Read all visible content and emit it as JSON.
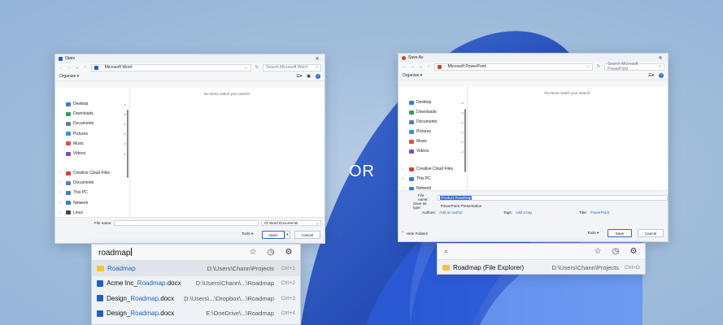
{
  "colors": {
    "accent": "#2e6fd0",
    "word": "#1f5fbf",
    "powerpoint": "#c9472b",
    "folder": "#f0c24a"
  },
  "separator": {
    "text": "OR"
  },
  "open_dialog": {
    "title": "Open",
    "address": "Microsoft Word",
    "search_placeholder": "Search Microsoft Word",
    "organize_label": "Organize ▾",
    "empty_message": "No items match your search.",
    "quick_access": [
      {
        "label": "Desktop",
        "icon": "desktop-icon",
        "color": "#3a7bd5"
      },
      {
        "label": "Downloads",
        "icon": "download-icon",
        "color": "#2f9e5f"
      },
      {
        "label": "Documents",
        "icon": "documents-icon",
        "color": "#5d7fa8"
      },
      {
        "label": "Pictures",
        "icon": "pictures-icon",
        "color": "#3b8fd6"
      },
      {
        "label": "Music",
        "icon": "music-icon",
        "color": "#d3544b"
      },
      {
        "label": "Videos",
        "icon": "videos-icon",
        "color": "#7c4bc4"
      }
    ],
    "tree": [
      {
        "label": "Creative Cloud Files",
        "icon": "cloud-icon",
        "color": "#d0413a"
      },
      {
        "label": "Documents",
        "icon": "documents-icon",
        "color": "#5d7fa8"
      },
      {
        "label": "This PC",
        "icon": "pc-icon",
        "color": "#3a7bd5"
      },
      {
        "label": "Network",
        "icon": "network-icon",
        "color": "#3a7bd5"
      },
      {
        "label": "Linux",
        "icon": "linux-icon",
        "color": "#444444"
      }
    ],
    "file_name_label": "File name:",
    "file_type": "All Word Documents",
    "tools_label": "Tools",
    "open_label": "Open",
    "cancel_label": "Cancel"
  },
  "save_dialog": {
    "title": "Save As",
    "address": "Microsoft PowerPoint",
    "search_placeholder": "Search Microsoft PowerPoint",
    "organize_label": "Organize ▾",
    "empty_message": "No items match your search.",
    "quick_access": [
      {
        "label": "Desktop",
        "icon": "desktop-icon",
        "color": "#3a7bd5"
      },
      {
        "label": "Downloads",
        "icon": "download-icon",
        "color": "#2f9e5f"
      },
      {
        "label": "Documents",
        "icon": "documents-icon",
        "color": "#5d7fa8"
      },
      {
        "label": "Pictures",
        "icon": "pictures-icon",
        "color": "#3b8fd6"
      },
      {
        "label": "Music",
        "icon": "music-icon",
        "color": "#d3544b"
      },
      {
        "label": "Videos",
        "icon": "videos-icon",
        "color": "#7c4bc4"
      }
    ],
    "tree": [
      {
        "label": "Creative Cloud Files",
        "icon": "cloud-icon",
        "color": "#d0413a"
      },
      {
        "label": "This PC",
        "icon": "pc-icon",
        "color": "#3a7bd5"
      },
      {
        "label": "Network",
        "icon": "network-icon",
        "color": "#3a7bd5"
      }
    ],
    "file_name_label": "File name:",
    "file_name_value": "Product Roadmap",
    "save_type_label": "Save as type:",
    "save_type_value": "PowerPoint Presentation",
    "authors_label": "Authors:",
    "authors_value": "Add an author",
    "tags_label": "Tags:",
    "tags_value": "Add a tag",
    "title_label": "Title:",
    "title_value": "PowerPoint",
    "hide_folders_label": "Hide Folders",
    "tools_label": "Tools",
    "save_label": "Save",
    "cancel_label": "Cancel"
  },
  "left_palette": {
    "query": "roadmap",
    "results": [
      {
        "icon": "folder-icon",
        "name_pre": "",
        "name_match": "Roadmap",
        "name_post": "",
        "path": "D:\\Users\\Chann\\Projects",
        "shortcut": "Ctrl+1",
        "highlight": true
      },
      {
        "icon": "word-icon",
        "name_pre": "Acme Inc_",
        "name_match": "Roadmap",
        "name_post": ".docx",
        "path": "D:\\Users\\Chann\\...\\Roadmap",
        "shortcut": "Ctrl+2",
        "highlight": false
      },
      {
        "icon": "word-icon",
        "name_pre": "Design_",
        "name_match": "Roadmap",
        "name_post": ".docx",
        "path": "D:\\Users\\...\\Dropbox\\...\\Roadmap",
        "shortcut": "Ctrl+3",
        "highlight": false
      },
      {
        "icon": "word-icon",
        "name_pre": "Design_",
        "name_match": "Roadmap",
        "name_post": ".docx",
        "path": "E:\\OneDrive\\...\\Roadmap",
        "shortcut": "Ctrl+4",
        "highlight": false
      }
    ]
  },
  "right_palette": {
    "results": [
      {
        "icon": "folder-icon",
        "name": "Roadmap (File Explorer)",
        "path": "D:\\Users\\Chann\\Projects",
        "shortcut": "Ctrl+G"
      }
    ]
  }
}
